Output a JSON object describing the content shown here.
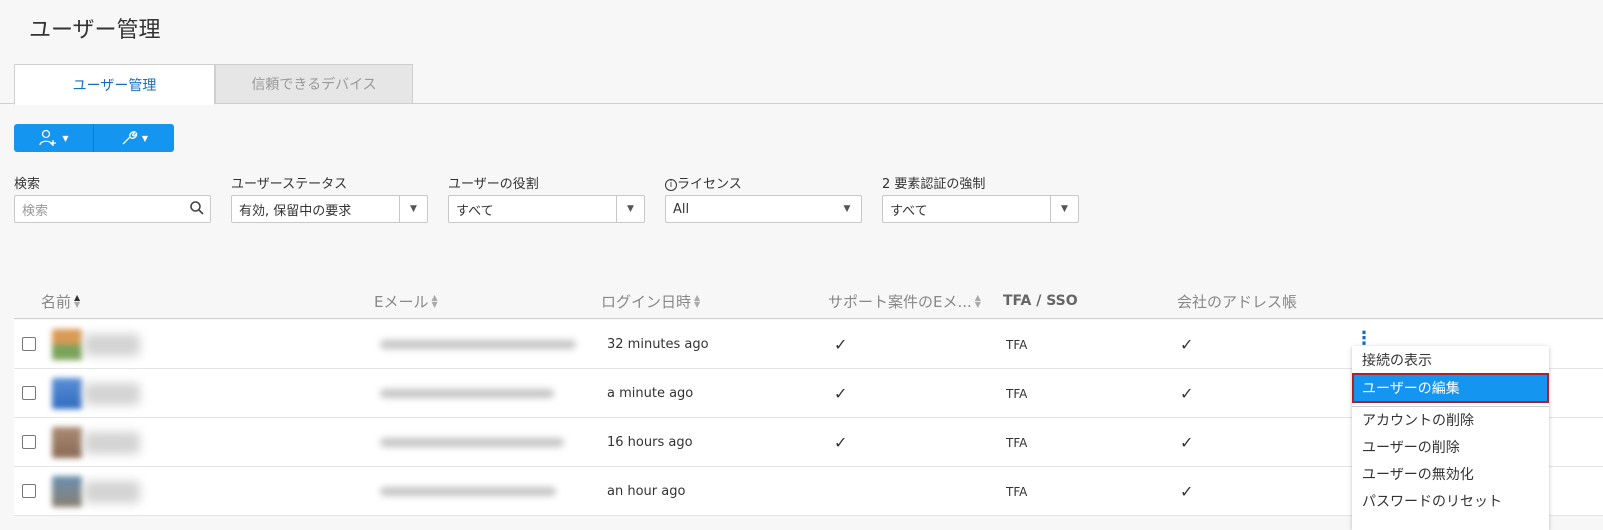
{
  "page": {
    "title": "ユーザー管理"
  },
  "tabs": [
    {
      "label": "ユーザー管理",
      "active": true
    },
    {
      "label": "信頼できるデバイス",
      "active": false
    }
  ],
  "toolbar": {
    "add_user_icon": "add-user-icon",
    "tools_icon": "wrench-icon",
    "accent_color": "#1496f0"
  },
  "filters": {
    "search": {
      "label": "検索",
      "placeholder": "検索"
    },
    "status": {
      "label": "ユーザーステータス",
      "value": "有効, 保留中の要求"
    },
    "role": {
      "label": "ユーザーの役割",
      "value": "すべて"
    },
    "license": {
      "label": "ライセンス",
      "value": "All"
    },
    "tfa": {
      "label": "2 要素認証の強制",
      "value": "すべて"
    }
  },
  "table": {
    "columns": [
      "名前",
      "Eメール",
      "ログイン日時",
      "サポート案件のEメ...",
      "TFA / SSO",
      "会社のアドレス帳"
    ],
    "rows": [
      {
        "login": "32 minutes ago",
        "support": "✓",
        "tfa": "TFA",
        "addressbook": "✓"
      },
      {
        "login": "a minute ago",
        "support": "✓",
        "tfa": "TFA",
        "addressbook": "✓"
      },
      {
        "login": "16 hours ago",
        "support": "✓",
        "tfa": "TFA",
        "addressbook": "✓"
      },
      {
        "login": "an hour ago",
        "support": "",
        "tfa": "TFA",
        "addressbook": "✓"
      }
    ]
  },
  "context_menu": {
    "items": [
      "接続の表示",
      "ユーザーの編集",
      "アカウントの削除",
      "ユーザーの削除",
      "ユーザーの無効化",
      "パスワードのリセット"
    ],
    "selected": "ユーザーの編集"
  }
}
